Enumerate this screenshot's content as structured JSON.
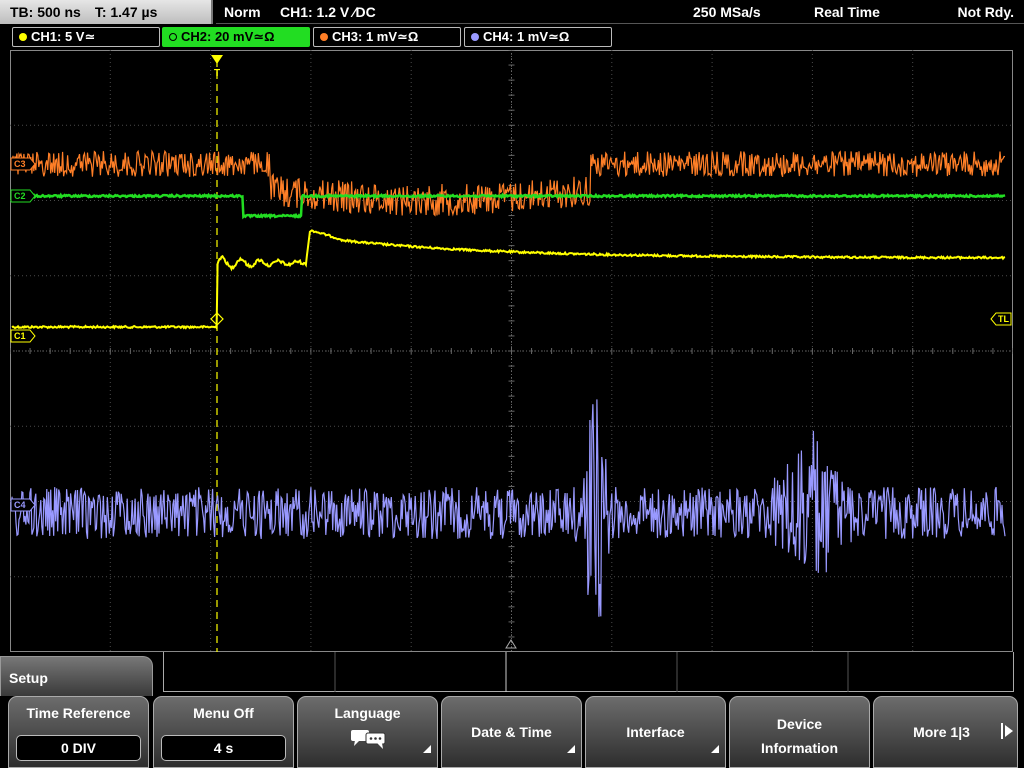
{
  "topbar": {
    "timebase": "TB: 500 ns",
    "trigger_time": "T: 1.47 µs",
    "mode": "Norm",
    "trigger": "CH1: 1.2 V ∕DC",
    "sample_rate": "250 MSa/s",
    "acq_mode": "Real Time",
    "state": "Not Rdy."
  },
  "channels": [
    {
      "label": "CH1: 5 V≃",
      "color": "#ffff00"
    },
    {
      "label": "CH2: 20 mV≃Ω",
      "color": "#22dd22"
    },
    {
      "label": "CH3: 1 mV≃Ω",
      "color": "#ff7f27"
    },
    {
      "label": "CH4: 1 mV≃Ω",
      "color": "#9999ff"
    }
  ],
  "markers": {
    "c1": "C1",
    "c2": "C2",
    "c3": "C3",
    "c4": "C4",
    "trigger_level": "TL"
  },
  "menu": {
    "title": "Setup",
    "softkeys": [
      {
        "label": "Time Reference",
        "value": "0 DIV"
      },
      {
        "label": "Menu Off",
        "value": "4 s"
      },
      {
        "label": "Language",
        "icon": "speech-bubbles-icon"
      },
      {
        "label": "Date & Time"
      },
      {
        "label": "Interface"
      },
      {
        "label1": "Device",
        "label2": "Information"
      },
      {
        "label": "More 1|3"
      }
    ]
  }
}
